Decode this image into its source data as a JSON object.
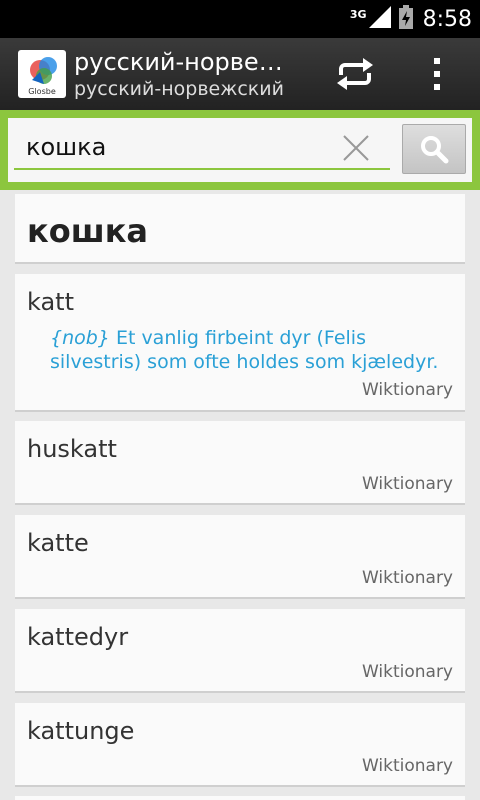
{
  "status_bar": {
    "network": "3G",
    "time": "8:58"
  },
  "action_bar": {
    "app_logo_text": "Glosbe",
    "title": "русский-норвежский",
    "subtitle": "русский-норвежский"
  },
  "search": {
    "value": "кошка"
  },
  "results": {
    "headword": "кошка",
    "entries": [
      {
        "term": "katt",
        "definition_lang": "{nob}",
        "definition": " Et vanlig firbeint dyr (Felis silvestris) som ofte holdes som kjæledyr.",
        "source": "Wiktionary"
      },
      {
        "term": "huskatt",
        "source": "Wiktionary"
      },
      {
        "term": "katte",
        "source": "Wiktionary"
      },
      {
        "term": "kattedyr",
        "source": "Wiktionary"
      },
      {
        "term": "kattunge",
        "source": "Wiktionary"
      }
    ]
  },
  "colors": {
    "accent": "#8cc63e",
    "definition": "#2aa0d6",
    "action_bar": "#2b2b2b"
  }
}
